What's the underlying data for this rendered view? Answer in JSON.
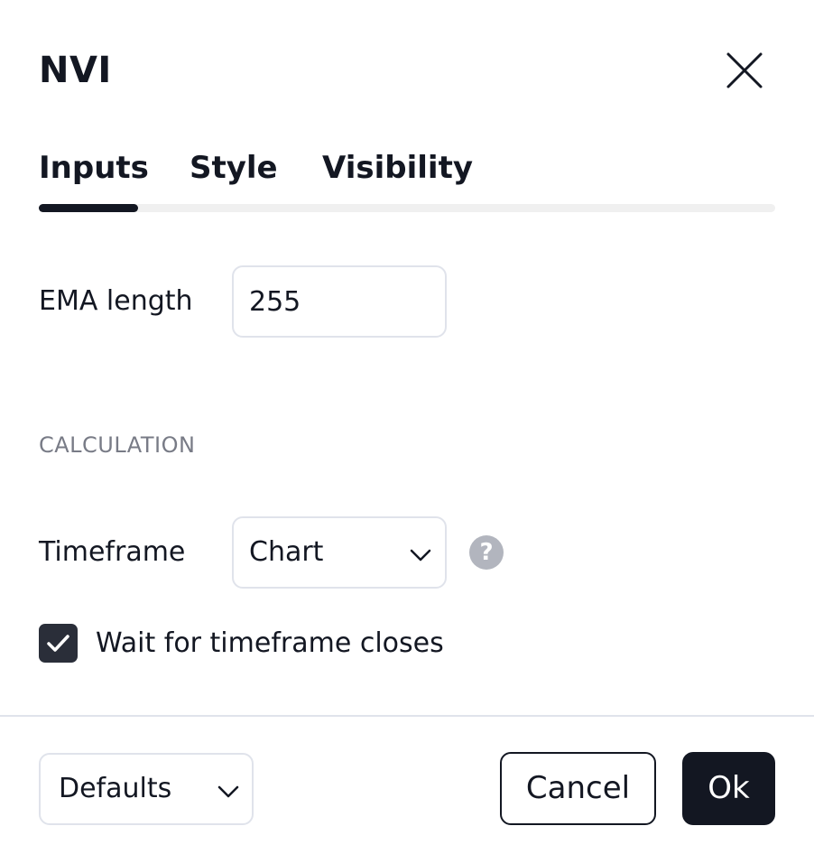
{
  "dialog": {
    "title": "NVI",
    "close_icon": "close-icon"
  },
  "tabs": [
    {
      "label": "Inputs",
      "active": true
    },
    {
      "label": "Style",
      "active": false
    },
    {
      "label": "Visibility",
      "active": false
    }
  ],
  "inputs": {
    "ema_length": {
      "label": "EMA length",
      "value": "255"
    },
    "section_title": "CALCULATION",
    "timeframe": {
      "label": "Timeframe",
      "value": "Chart",
      "help_icon": "question-icon"
    },
    "wait_closes": {
      "label": "Wait for timeframe closes",
      "checked": true
    }
  },
  "footer": {
    "defaults_label": "Defaults",
    "cancel_label": "Cancel",
    "ok_label": "Ok"
  },
  "colors": {
    "text": "#131722",
    "muted": "#787b86",
    "border": "#e0e3eb",
    "help": "#b2b5be",
    "checkbox": "#2a2e39"
  }
}
